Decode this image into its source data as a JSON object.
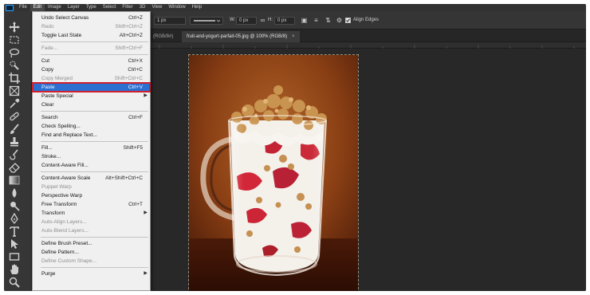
{
  "app": {
    "name": "Photoshop"
  },
  "menubar": {
    "items": [
      "File",
      "Edit",
      "Image",
      "Layer",
      "Type",
      "Select",
      "Filter",
      "3D",
      "View",
      "Window",
      "Help"
    ]
  },
  "options_bar": {
    "stroke_width": "1 px",
    "w_label": "W:",
    "w_value": "0 px",
    "h_label": "H:",
    "h_value": "0 px",
    "align_edges_label": "Align Edges",
    "align_edges_checked": true
  },
  "tabs": [
    {
      "label": "(RGB/8#)",
      "active": false
    },
    {
      "label": "fruit-and-yogurt-parfait-05.jpg @ 100% (RGB/8)",
      "close": "×",
      "active": true
    }
  ],
  "edit_menu": {
    "groups": [
      [
        {
          "label": "Undo Select Canvas",
          "shortcut": "Ctrl+Z",
          "enabled": true
        },
        {
          "label": "Redo",
          "shortcut": "Shift+Ctrl+Z",
          "enabled": false
        },
        {
          "label": "Toggle Last State",
          "shortcut": "Alt+Ctrl+Z",
          "enabled": true
        }
      ],
      [
        {
          "label": "Fade...",
          "shortcut": "Shift+Ctrl+F",
          "enabled": false
        }
      ],
      [
        {
          "label": "Cut",
          "shortcut": "Ctrl+X",
          "enabled": true
        },
        {
          "label": "Copy",
          "shortcut": "Ctrl+C",
          "enabled": true
        },
        {
          "label": "Copy Merged",
          "shortcut": "Shift+Ctrl+C",
          "enabled": false
        },
        {
          "label": "Paste",
          "shortcut": "Ctrl+V",
          "enabled": true,
          "highlighted": true
        },
        {
          "label": "Paste Special",
          "submenu": true,
          "enabled": true
        },
        {
          "label": "Clear",
          "enabled": true
        }
      ],
      [
        {
          "label": "Search",
          "shortcut": "Ctrl+F",
          "enabled": true
        },
        {
          "label": "Check Spelling...",
          "enabled": true
        },
        {
          "label": "Find and Replace Text...",
          "enabled": true
        }
      ],
      [
        {
          "label": "Fill...",
          "shortcut": "Shift+F5",
          "enabled": true
        },
        {
          "label": "Stroke...",
          "enabled": true
        },
        {
          "label": "Content-Aware Fill...",
          "enabled": true
        }
      ],
      [
        {
          "label": "Content-Aware Scale",
          "shortcut": "Alt+Shift+Ctrl+C",
          "enabled": true
        },
        {
          "label": "Puppet Warp",
          "enabled": false
        },
        {
          "label": "Perspective Warp",
          "enabled": true
        },
        {
          "label": "Free Transform",
          "shortcut": "Ctrl+T",
          "enabled": true
        },
        {
          "label": "Transform",
          "submenu": true,
          "enabled": true
        },
        {
          "label": "Auto-Align Layers...",
          "enabled": false
        },
        {
          "label": "Auto-Blend Layers...",
          "enabled": false
        }
      ],
      [
        {
          "label": "Define Brush Preset...",
          "enabled": true
        },
        {
          "label": "Define Pattern...",
          "enabled": true
        },
        {
          "label": "Define Custom Shape...",
          "enabled": false
        }
      ],
      [
        {
          "label": "Purge",
          "submenu": true,
          "enabled": true
        }
      ]
    ]
  },
  "toolbar": {
    "tools": [
      "move-tool",
      "marquee-tool",
      "lasso-tool",
      "quick-select-tool",
      "crop-tool",
      "frame-tool",
      "eyedropper-tool",
      "healing-brush-tool",
      "brush-tool",
      "clone-stamp-tool",
      "history-brush-tool",
      "eraser-tool",
      "gradient-tool",
      "blur-tool",
      "dodge-tool",
      "pen-tool",
      "type-tool",
      "path-select-tool",
      "rectangle-tool",
      "hand-tool",
      "zoom-tool"
    ]
  },
  "colors": {
    "menu_highlight": "#2b6fd1",
    "highlight_outline": "#d0202e",
    "workspace": "#282828"
  }
}
